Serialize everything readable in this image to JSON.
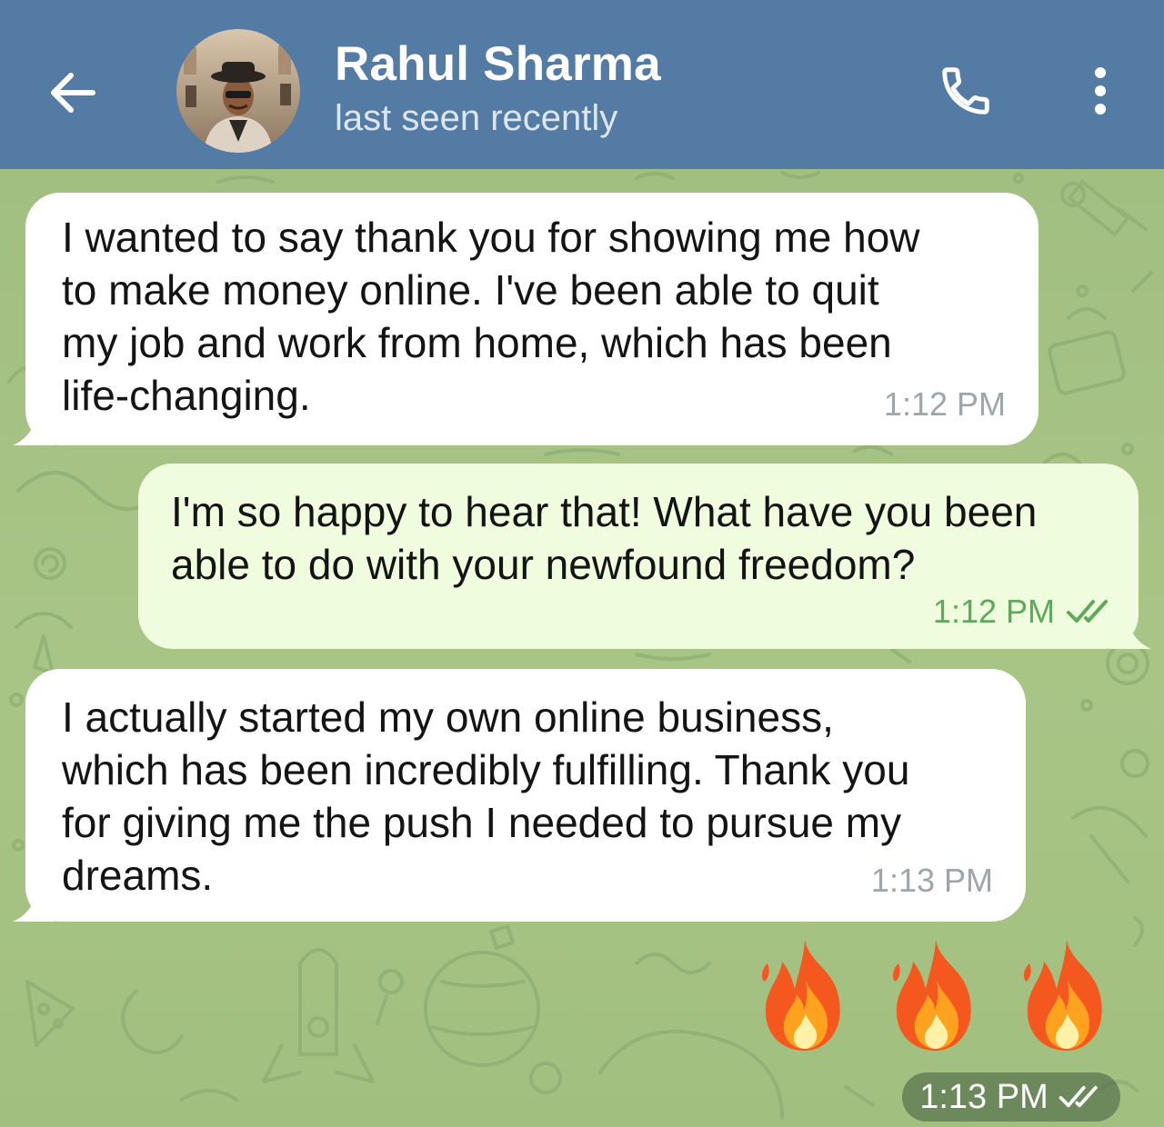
{
  "header": {
    "contact_name": "Rahul Sharma",
    "status": "last seen recently",
    "icons": {
      "back": "arrow-left-icon",
      "call": "phone-icon",
      "more": "vertical-dots-icon"
    }
  },
  "messages": [
    {
      "direction": "incoming",
      "text": "I wanted to say thank you for showing me how\nto make money online. I've been able to quit\nmy job and work from home, which has been\nlife-changing.",
      "time": "1:12 PM"
    },
    {
      "direction": "outgoing",
      "text": "I'm so happy to hear that! What have you been\nable to do with your newfound freedom?",
      "time": "1:12 PM",
      "status": "read"
    },
    {
      "direction": "incoming",
      "text": "I actually started my own online business,\nwhich has been incredibly fulfilling. Thank you\nfor giving me the push I needed to pursue my\ndreams.",
      "time": "1:13 PM"
    },
    {
      "direction": "outgoing",
      "emoji": "fire-emoji",
      "emoji_count": 3,
      "time": "1:13 PM",
      "status": "read"
    }
  ],
  "colors": {
    "header": "#537ba4",
    "incoming_bubble": "#ffffff",
    "outgoing_bubble": "#effdde",
    "outgoing_time": "#5ea95a",
    "incoming_time": "#9ea5ac",
    "chat_background": "#a4c183"
  }
}
